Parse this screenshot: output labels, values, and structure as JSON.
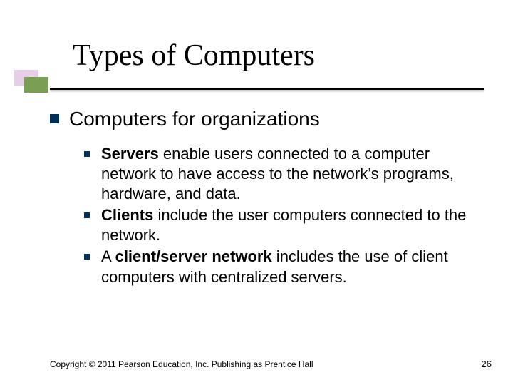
{
  "title": "Types of Computers",
  "body": {
    "heading": "Computers for organizations",
    "items": [
      {
        "bold": "Servers",
        "rest": " enable users connected to a computer network to have access to the network’s programs, hardware, and data."
      },
      {
        "bold": "Clients",
        "rest": " include the user computers connected to the network."
      },
      {
        "pre": "A ",
        "bold": "client/server network",
        "rest": " includes the use of client computers with centralized servers."
      }
    ]
  },
  "footer": {
    "copyright": "Copyright © 2011 Pearson Education, Inc. Publishing as Prentice Hall",
    "page": "26"
  }
}
